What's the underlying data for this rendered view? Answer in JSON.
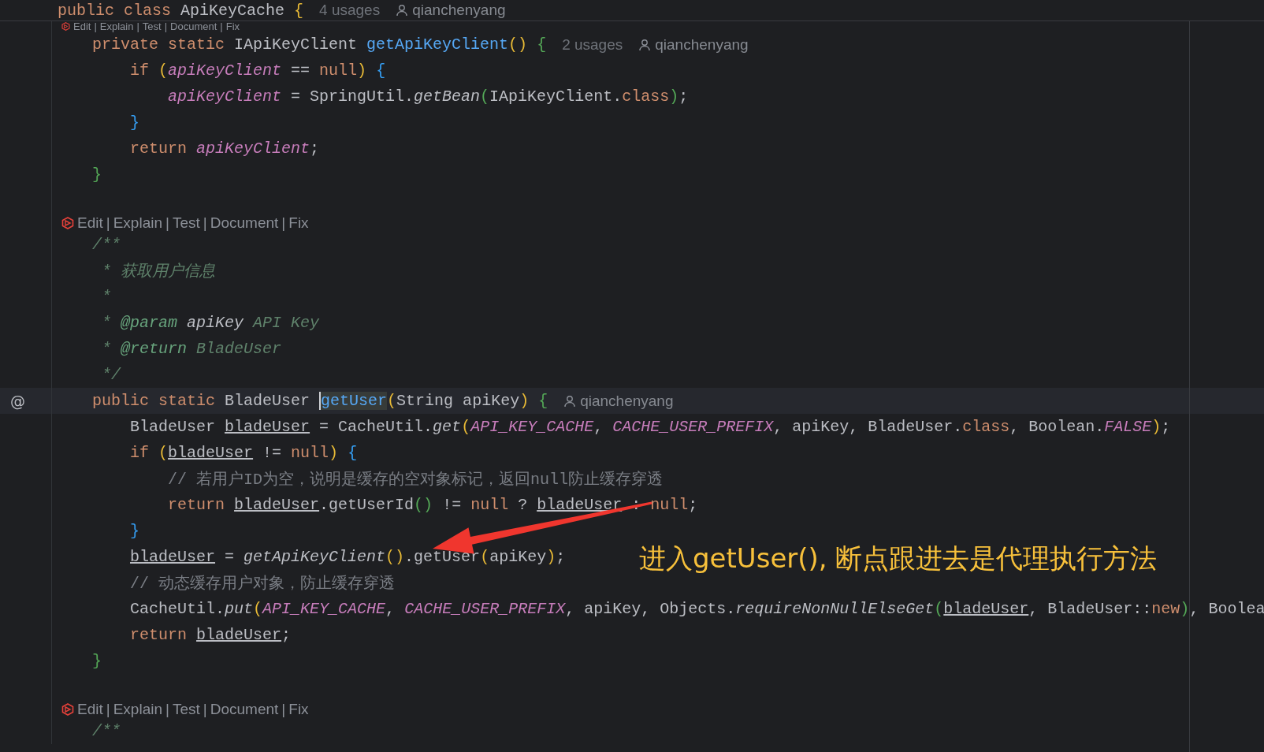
{
  "editor": {
    "sticky_header": {
      "tokens": [
        {
          "text": "public class ",
          "kind": "kw"
        },
        {
          "text": "ApiKeyCache ",
          "kind": "p"
        },
        {
          "text": "{",
          "kind": "b1"
        }
      ],
      "hints": [
        {
          "kind": "usages",
          "text": "4 usages"
        },
        {
          "kind": "author",
          "text": "qianchenyang"
        }
      ]
    },
    "lines": [
      {
        "kind": "lens",
        "cut": true,
        "separator": "|",
        "actions": [
          "Edit",
          "Explain",
          "Test",
          "Document",
          "Fix"
        ]
      },
      {
        "kind": "code",
        "current": false,
        "tokens": [
          {
            "text": "    private static ",
            "kind": "kw"
          },
          {
            "text": "IApiKeyClient ",
            "kind": "p"
          },
          {
            "text": "getApiKeyClient",
            "kind": "fn"
          },
          {
            "text": "() ",
            "kind": "b1"
          },
          {
            "text": "{",
            "kind": "b2"
          }
        ],
        "hints": [
          {
            "kind": "usages",
            "text": "2 usages"
          },
          {
            "kind": "author",
            "text": "qianchenyang"
          }
        ]
      },
      {
        "kind": "code",
        "current": false,
        "tokens": [
          {
            "text": "        if ",
            "kind": "kw"
          },
          {
            "text": "(",
            "kind": "b1"
          },
          {
            "text": "apiKeyClient",
            "kind": "fld"
          },
          {
            "text": " == ",
            "kind": "p"
          },
          {
            "text": "null",
            "kind": "kw"
          },
          {
            "text": ") ",
            "kind": "b1"
          },
          {
            "text": "{",
            "kind": "b3"
          }
        ]
      },
      {
        "kind": "code",
        "current": false,
        "tokens": [
          {
            "text": "            apiKeyClient",
            "kind": "fld"
          },
          {
            "text": " = SpringUtil.",
            "kind": "p"
          },
          {
            "text": "getBean",
            "kind": "it"
          },
          {
            "text": "(",
            "kind": "b2"
          },
          {
            "text": "IApiKeyClient.",
            "kind": "p"
          },
          {
            "text": "class",
            "kind": "kw"
          },
          {
            "text": ")",
            "kind": "b2"
          },
          {
            "text": ";",
            "kind": "p"
          }
        ]
      },
      {
        "kind": "code",
        "current": false,
        "tokens": [
          {
            "text": "        }",
            "kind": "b3"
          }
        ]
      },
      {
        "kind": "code",
        "current": false,
        "tokens": [
          {
            "text": "        return ",
            "kind": "kw"
          },
          {
            "text": "apiKeyClient",
            "kind": "fld"
          },
          {
            "text": ";",
            "kind": "p"
          }
        ]
      },
      {
        "kind": "code",
        "current": false,
        "tokens": [
          {
            "text": "    }",
            "kind": "b2"
          }
        ]
      },
      {
        "kind": "blank"
      },
      {
        "kind": "lens",
        "cut": false,
        "separator": "|",
        "actions": [
          "Edit",
          "Explain",
          "Test",
          "Document",
          "Fix"
        ]
      },
      {
        "kind": "code",
        "current": false,
        "tokens": [
          {
            "text": "    /**",
            "kind": "doc"
          }
        ]
      },
      {
        "kind": "code",
        "current": false,
        "tokens": [
          {
            "text": "     * 获取用户信息",
            "kind": "doc"
          }
        ]
      },
      {
        "kind": "code",
        "current": false,
        "tokens": [
          {
            "text": "     *",
            "kind": "doc"
          }
        ]
      },
      {
        "kind": "code",
        "current": false,
        "tokens": [
          {
            "text": "     * ",
            "kind": "doc"
          },
          {
            "text": "@param",
            "kind": "tag"
          },
          {
            "text": " apiKey",
            "kind": "docp"
          },
          {
            "text": " API Key",
            "kind": "doc"
          }
        ]
      },
      {
        "kind": "code",
        "current": false,
        "tokens": [
          {
            "text": "     * ",
            "kind": "doc"
          },
          {
            "text": "@return",
            "kind": "tag"
          },
          {
            "text": " BladeUser",
            "kind": "doc"
          }
        ]
      },
      {
        "kind": "code",
        "current": false,
        "tokens": [
          {
            "text": "     */",
            "kind": "doc"
          }
        ]
      },
      {
        "kind": "code",
        "current": true,
        "gutter_mark": "@",
        "tokens": [
          {
            "text": "    public static ",
            "kind": "kw"
          },
          {
            "text": "BladeUser ",
            "kind": "p"
          },
          {
            "text": "getUser",
            "kind": "fnsel"
          },
          {
            "text": "(",
            "kind": "b1"
          },
          {
            "text": "String apiKey",
            "kind": "p"
          },
          {
            "text": ") ",
            "kind": "b1"
          },
          {
            "text": "{",
            "kind": "b2"
          }
        ],
        "hints": [
          {
            "kind": "author",
            "text": "qianchenyang"
          }
        ]
      },
      {
        "kind": "code",
        "current": false,
        "tokens": [
          {
            "text": "        BladeUser ",
            "kind": "p"
          },
          {
            "text": "bladeUser",
            "kind": "u"
          },
          {
            "text": " = CacheUtil.",
            "kind": "p"
          },
          {
            "text": "get",
            "kind": "it"
          },
          {
            "text": "(",
            "kind": "b1"
          },
          {
            "text": "API_KEY_CACHE",
            "kind": "cst"
          },
          {
            "text": ", ",
            "kind": "p"
          },
          {
            "text": "CACHE_USER_PREFIX",
            "kind": "cst"
          },
          {
            "text": ", apiKey, BladeUser.",
            "kind": "p"
          },
          {
            "text": "class",
            "kind": "kw"
          },
          {
            "text": ", Boolean.",
            "kind": "p"
          },
          {
            "text": "FALSE",
            "kind": "cst"
          },
          {
            "text": ")",
            "kind": "b1"
          },
          {
            "text": ";",
            "kind": "p"
          }
        ]
      },
      {
        "kind": "code",
        "current": false,
        "tokens": [
          {
            "text": "        if ",
            "kind": "kw"
          },
          {
            "text": "(",
            "kind": "b1"
          },
          {
            "text": "bladeUser",
            "kind": "u"
          },
          {
            "text": " != ",
            "kind": "p"
          },
          {
            "text": "null",
            "kind": "kw"
          },
          {
            "text": ") ",
            "kind": "b1"
          },
          {
            "text": "{",
            "kind": "b3"
          }
        ]
      },
      {
        "kind": "code",
        "current": false,
        "tokens": [
          {
            "text": "            // 若用户ID为空，说明是缓存的空对象标记，返回null防止缓存穿透",
            "kind": "cm"
          }
        ]
      },
      {
        "kind": "code",
        "current": false,
        "tokens": [
          {
            "text": "            return ",
            "kind": "kw"
          },
          {
            "text": "bladeUser",
            "kind": "u"
          },
          {
            "text": ".getUserId",
            "kind": "p"
          },
          {
            "text": "()",
            "kind": "b2"
          },
          {
            "text": " != ",
            "kind": "p"
          },
          {
            "text": "null",
            "kind": "kw"
          },
          {
            "text": " ? ",
            "kind": "p"
          },
          {
            "text": "bladeUser",
            "kind": "u"
          },
          {
            "text": " : ",
            "kind": "p"
          },
          {
            "text": "null",
            "kind": "kw"
          },
          {
            "text": ";",
            "kind": "p"
          }
        ]
      },
      {
        "kind": "code",
        "current": false,
        "tokens": [
          {
            "text": "        }",
            "kind": "b3"
          }
        ]
      },
      {
        "kind": "code",
        "current": false,
        "tokens": [
          {
            "text": "        bladeUser",
            "kind": "u"
          },
          {
            "text": " = ",
            "kind": "p"
          },
          {
            "text": "getApiKeyClient",
            "kind": "it"
          },
          {
            "text": "()",
            "kind": "b1"
          },
          {
            "text": ".getUser",
            "kind": "p"
          },
          {
            "text": "(",
            "kind": "b1"
          },
          {
            "text": "apiKey",
            "kind": "p"
          },
          {
            "text": ")",
            "kind": "b1"
          },
          {
            "text": ";",
            "kind": "p"
          }
        ]
      },
      {
        "kind": "code",
        "current": false,
        "tokens": [
          {
            "text": "        // 动态缓存用户对象，防止缓存穿透",
            "kind": "cm"
          }
        ]
      },
      {
        "kind": "code",
        "current": false,
        "tokens": [
          {
            "text": "        CacheUtil.",
            "kind": "p"
          },
          {
            "text": "put",
            "kind": "it"
          },
          {
            "text": "(",
            "kind": "b1"
          },
          {
            "text": "API_KEY_CACHE",
            "kind": "cst"
          },
          {
            "text": ", ",
            "kind": "p"
          },
          {
            "text": "CACHE_USER_PREFIX",
            "kind": "cst"
          },
          {
            "text": ", apiKey, Objects.",
            "kind": "p"
          },
          {
            "text": "requireNonNullElseGet",
            "kind": "it"
          },
          {
            "text": "(",
            "kind": "b2"
          },
          {
            "text": "bladeUser",
            "kind": "u"
          },
          {
            "text": ", BladeUser::",
            "kind": "p"
          },
          {
            "text": "new",
            "kind": "kw"
          },
          {
            "text": ")",
            "kind": "b2"
          },
          {
            "text": ", Boolea",
            "kind": "p"
          }
        ]
      },
      {
        "kind": "code",
        "current": false,
        "tokens": [
          {
            "text": "        return ",
            "kind": "kw"
          },
          {
            "text": "bladeUser",
            "kind": "u"
          },
          {
            "text": ";",
            "kind": "p"
          }
        ]
      },
      {
        "kind": "code",
        "current": false,
        "tokens": [
          {
            "text": "    }",
            "kind": "b2"
          }
        ]
      },
      {
        "kind": "blank"
      },
      {
        "kind": "lens",
        "cut": false,
        "separator": "|",
        "actions": [
          "Edit",
          "Explain",
          "Test",
          "Document",
          "Fix"
        ]
      },
      {
        "kind": "code",
        "current": false,
        "tokens": [
          {
            "text": "    /**",
            "kind": "doc"
          }
        ]
      }
    ]
  },
  "annotation": {
    "text": "进入getUser(), 断点跟进去是代理执行方法"
  }
}
